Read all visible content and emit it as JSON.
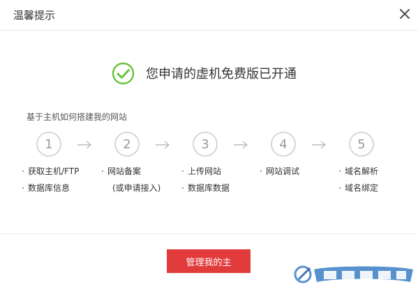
{
  "dialog": {
    "title": "温馨提示",
    "success_message": "您申请的虚机免费版已开通",
    "subtitle": "基于主机如何搭建我的网站",
    "steps": [
      {
        "number": "1",
        "items": [
          "获取主机/FTP",
          "数据库信息"
        ]
      },
      {
        "number": "2",
        "items": [
          "网站备案",
          "(或申请接入)"
        ]
      },
      {
        "number": "3",
        "items": [
          "上传网站",
          "数据库数据"
        ]
      },
      {
        "number": "4",
        "items": [
          "网站调试"
        ]
      },
      {
        "number": "5",
        "items": [
          "域名解析",
          "域名绑定"
        ]
      }
    ],
    "manage_button_label": "管理我的主"
  },
  "icons": {
    "close": "close-icon",
    "success": "check-circle-icon",
    "arrow": "arrow-right-icon"
  },
  "colors": {
    "success_green": "#67c23a",
    "button_red": "#e13b3c",
    "step_gray": "#9a9a9a"
  }
}
